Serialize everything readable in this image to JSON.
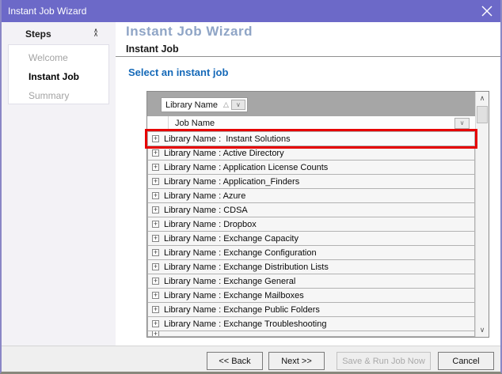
{
  "window": {
    "title": "Instant Job Wizard"
  },
  "sidebar": {
    "header": "Steps",
    "items": [
      {
        "label": "Welcome",
        "state": "inactive"
      },
      {
        "label": "Instant Job",
        "state": "active"
      },
      {
        "label": "Summary",
        "state": "inactive"
      }
    ]
  },
  "main": {
    "heading": "Instant Job Wizard",
    "subheading": "Instant Job",
    "section_label": "Select an instant job",
    "grid": {
      "group_chip": {
        "label": "Library Name",
        "sort_icon": "△",
        "dropdown_icon": "∨"
      },
      "column_header": "Job Name",
      "filter_icon": "∨",
      "rows": [
        {
          "label": "Library Name :  Instant Solutions",
          "highlighted": true
        },
        {
          "label": "Library Name : Active Directory"
        },
        {
          "label": "Library Name : Application License Counts"
        },
        {
          "label": "Library Name : Application_Finders"
        },
        {
          "label": "Library Name : Azure"
        },
        {
          "label": "Library Name : CDSA"
        },
        {
          "label": "Library Name : Dropbox"
        },
        {
          "label": "Library Name : Exchange Capacity"
        },
        {
          "label": "Library Name : Exchange Configuration"
        },
        {
          "label": "Library Name : Exchange Distribution Lists"
        },
        {
          "label": "Library Name : Exchange General"
        },
        {
          "label": "Library Name : Exchange Mailboxes"
        },
        {
          "label": "Library Name : Exchange Public Folders"
        },
        {
          "label": "Library Name : Exchange Troubleshooting"
        },
        {
          "label": "",
          "partial": true
        }
      ],
      "scrollbar": {
        "up_icon": "∧",
        "down_icon": "∨"
      }
    }
  },
  "footer": {
    "buttons": [
      {
        "label": "<< Back",
        "enabled": true
      },
      {
        "label": "Next >>",
        "enabled": true
      },
      {
        "label": "Save & Run Job Now",
        "enabled": false
      },
      {
        "label": "Cancel",
        "enabled": true
      }
    ]
  },
  "colors": {
    "titlebar": "#6c69c8",
    "heading": "#8fa5c6",
    "section_label": "#1569b8",
    "group_band": "#a6a6a6",
    "highlight_annotation": "#e60000",
    "sidebar_bg": "#f3f2f6"
  }
}
